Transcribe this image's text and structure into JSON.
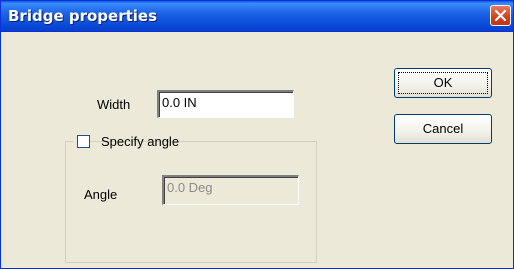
{
  "window": {
    "title": "Bridge properties"
  },
  "titlebar": {
    "close_icon": "close-icon"
  },
  "fields": {
    "width": {
      "label": "Width",
      "value": "0.0 IN"
    },
    "angle": {
      "label": "Angle",
      "value": "0.0 Deg",
      "disabled": true
    }
  },
  "group": {
    "checkbox_label": "Specify angle",
    "checked": false
  },
  "buttons": {
    "ok": "OK",
    "cancel": "Cancel"
  }
}
